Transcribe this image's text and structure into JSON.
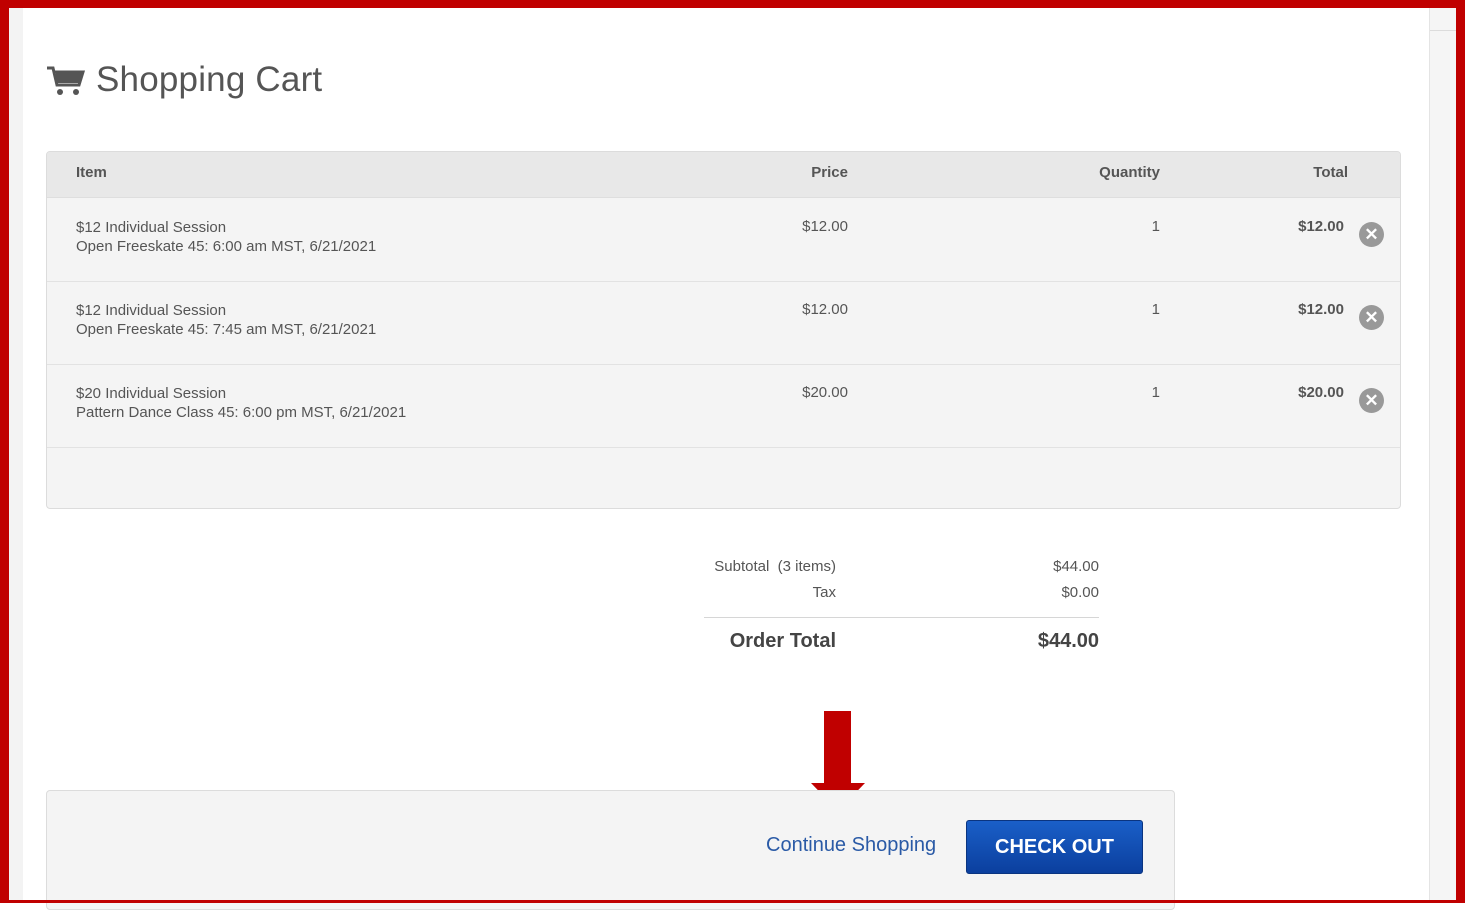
{
  "page": {
    "title": "Shopping Cart"
  },
  "table": {
    "headers": {
      "item": "Item",
      "price": "Price",
      "quantity": "Quantity",
      "total": "Total"
    },
    "rows": [
      {
        "name": "$12 Individual Session",
        "detail": "Open Freeskate 45: 6:00 am MST, 6/21/2021",
        "price": "$12.00",
        "quantity": "1",
        "total": "$12.00"
      },
      {
        "name": "$12 Individual Session",
        "detail": "Open Freeskate 45: 7:45 am MST, 6/21/2021",
        "price": "$12.00",
        "quantity": "1",
        "total": "$12.00"
      },
      {
        "name": "$20 Individual Session",
        "detail": "Pattern Dance Class 45: 6:00 pm MST, 6/21/2021",
        "price": "$20.00",
        "quantity": "1",
        "total": "$20.00"
      }
    ]
  },
  "summary": {
    "subtotal_label": "Subtotal  (3 items)",
    "subtotal_value": "$44.00",
    "tax_label": "Tax",
    "tax_value": "$0.00",
    "order_total_label": "Order Total",
    "order_total_value": "$44.00"
  },
  "actions": {
    "continue_label": "Continue Shopping",
    "checkout_label": "CHECK OUT"
  },
  "colors": {
    "highlight_frame": "#c00000",
    "checkout_button": "#0b4bb3",
    "link": "#2a5aa6"
  },
  "icons": {
    "title_icon": "shopping-cart-icon",
    "remove_icon": "remove-circle-icon",
    "annotation": "down-arrow-annotation"
  }
}
